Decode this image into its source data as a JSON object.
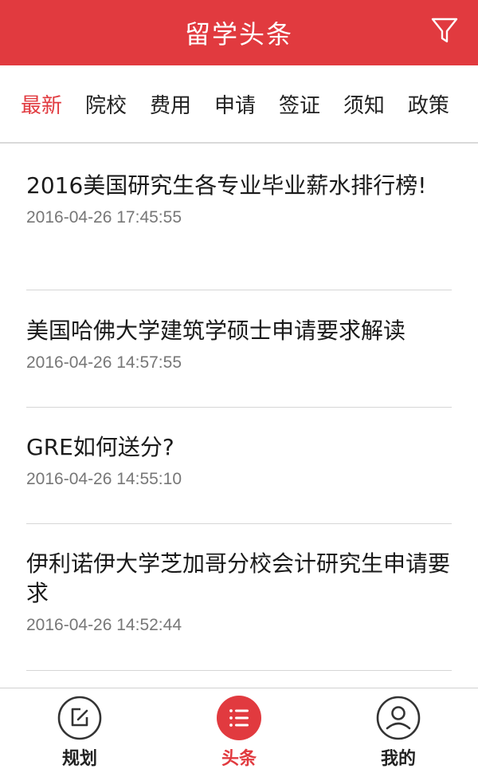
{
  "header": {
    "title": "留学头条"
  },
  "tabs": [
    {
      "label": "最新",
      "active": true
    },
    {
      "label": "院校",
      "active": false
    },
    {
      "label": "费用",
      "active": false
    },
    {
      "label": "申请",
      "active": false
    },
    {
      "label": "签证",
      "active": false
    },
    {
      "label": "须知",
      "active": false
    },
    {
      "label": "政策",
      "active": false
    }
  ],
  "articles": [
    {
      "title": "2016美国研究生各专业毕业薪水排行榜!",
      "time": "2016-04-26 17:45:55"
    },
    {
      "title": "美国哈佛大学建筑学硕士申请要求解读",
      "time": "2016-04-26 14:57:55"
    },
    {
      "title": "GRE如何送分?",
      "time": "2016-04-26 14:55:10"
    },
    {
      "title": "伊利诺伊大学芝加哥分校会计研究生申请要求",
      "time": "2016-04-26 14:52:44"
    }
  ],
  "bottom_nav": [
    {
      "label": "规划",
      "icon": "edit-icon",
      "active": false
    },
    {
      "label": "头条",
      "icon": "list-icon",
      "active": true
    },
    {
      "label": "我的",
      "icon": "user-icon",
      "active": false
    }
  ],
  "colors": {
    "accent": "#e13a3f",
    "divider": "#d6d6d6",
    "time_text": "#777777"
  }
}
